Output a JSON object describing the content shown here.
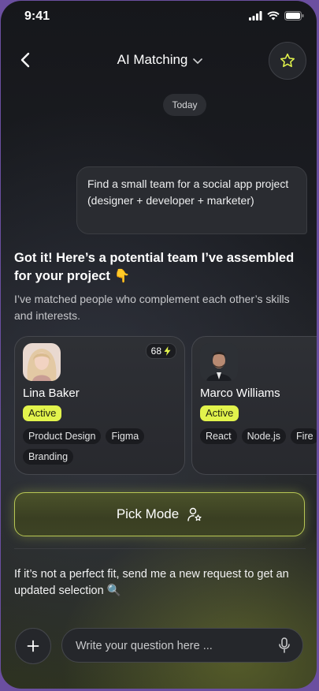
{
  "status_bar": {
    "time": "9:41"
  },
  "header": {
    "title": "AI Matching"
  },
  "chat": {
    "date_label": "Today",
    "user_message": "Find a small team for a social app project (designer + developer + marketer)",
    "ai_title": "Got it! Here’s a potential team I’ve assembled for your project 👇",
    "ai_subtitle": "I’ve matched people who complement each other’s skills and interests.",
    "ai_note": "If it’s not a perfect fit, send me a new request to get an updated selection 🔍"
  },
  "candidates": [
    {
      "name": "Lina Baker",
      "status": "Active",
      "score": "68",
      "tags": [
        "Product Design",
        "Figma",
        "Branding"
      ]
    },
    {
      "name": "Marco Williams",
      "status": "Active",
      "tags": [
        "React",
        "Node.js",
        "Fire"
      ]
    }
  ],
  "pick_button": {
    "label": "Pick Mode"
  },
  "composer": {
    "placeholder": "Write your question here ..."
  },
  "colors": {
    "accent": "#e2f34c",
    "background": "#1b1d22",
    "button_border": "#b7c654"
  },
  "icons": [
    "back-arrow-icon",
    "chevron-down-icon",
    "star-icon",
    "lightning-icon",
    "user-star-icon",
    "plus-icon",
    "microphone-icon"
  ]
}
